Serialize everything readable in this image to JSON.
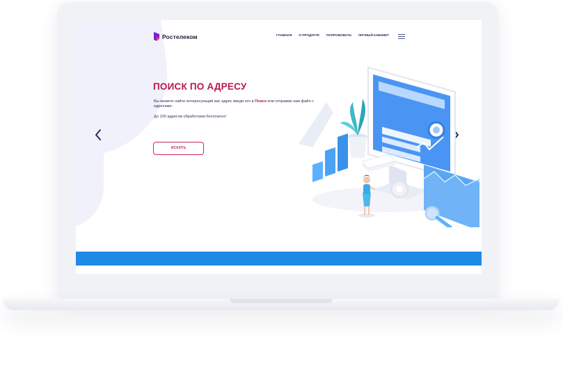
{
  "brand": {
    "name": "Ростелеком",
    "logo_color": "#7a1fd1",
    "accent_color": "#b8194a"
  },
  "nav": {
    "items": [
      "ГЛАВНАЯ",
      "О ПРОДУКТЕ",
      "ПОПРОБОВАТЬ",
      "ЛИЧНЫЙ КАБИНЕТ"
    ],
    "menu_icon": "hamburger-menu-icon"
  },
  "hero": {
    "title": "ПОИСК ПО АДРЕСУ",
    "desc_before": "Вы можете найти интересующий вас адрес введя его в ",
    "desc_highlight": "Поиск",
    "desc_after": " или отправив нам файл с адресами.",
    "note": "До 100 адресов обработаем бесплатно!",
    "button_label": "ИСКАТЬ"
  },
  "carousel": {
    "prev_icon": "chevron-left-icon",
    "next_icon": "chevron-right-icon"
  },
  "footer_bar": {
    "color": "#1f89e6"
  }
}
